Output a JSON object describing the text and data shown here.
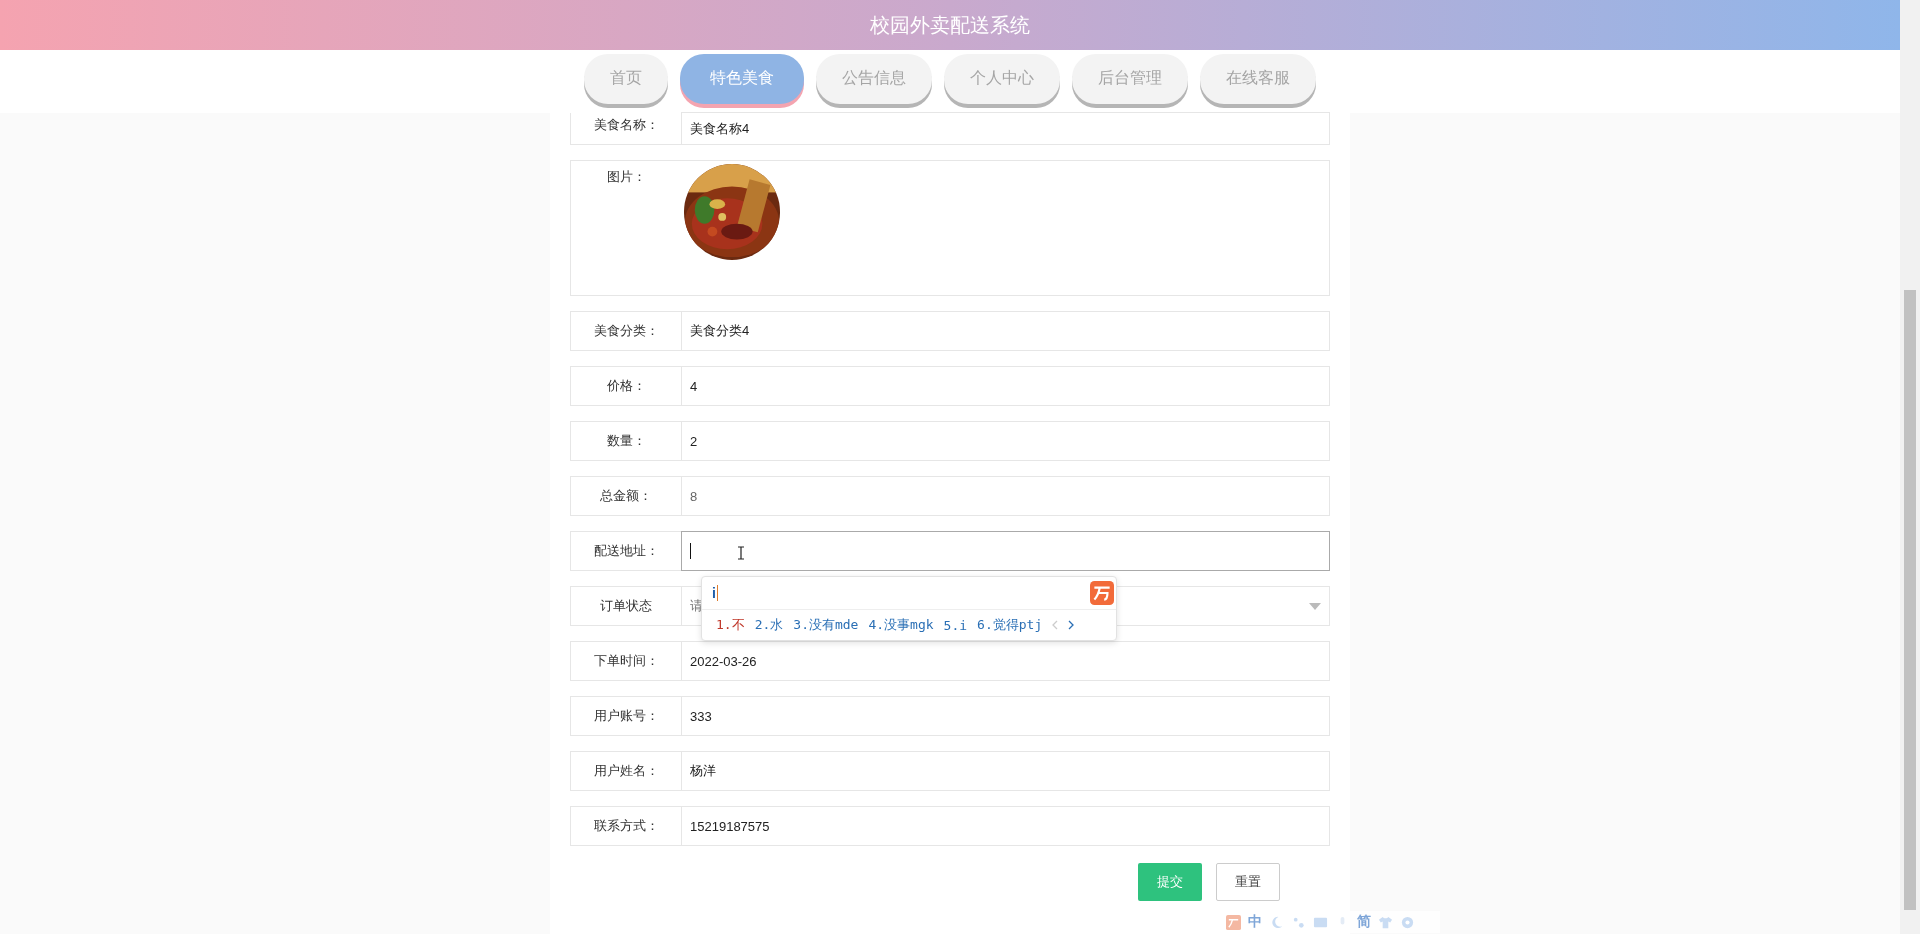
{
  "header": {
    "title": "校园外卖配送系统"
  },
  "nav": [
    {
      "label": "首页",
      "selected": false
    },
    {
      "label": "特色美食",
      "selected": true
    },
    {
      "label": "公告信息",
      "selected": false
    },
    {
      "label": "个人中心",
      "selected": false
    },
    {
      "label": "后台管理",
      "selected": false
    },
    {
      "label": "在线客服",
      "selected": false
    }
  ],
  "form": {
    "fields": [
      {
        "kind": "text",
        "label": "美食名称：",
        "value": "美食名称4",
        "readonly": false,
        "focused": false
      },
      {
        "label": "图片："
      },
      {
        "kind": "text",
        "label": "美食分类：",
        "value": "美食分类4",
        "readonly": false,
        "focused": false
      },
      {
        "kind": "text",
        "label": "价格：",
        "value": "4",
        "readonly": false,
        "focused": false
      },
      {
        "kind": "text",
        "label": "数量：",
        "value": "2",
        "readonly": false,
        "focused": false
      },
      {
        "kind": "text",
        "label": "总金额：",
        "value": "8",
        "readonly": true,
        "focused": false
      },
      {
        "kind": "text",
        "label": "配送地址：",
        "readonly": false,
        "focused": true
      },
      {
        "kind": "select",
        "label": "订单状态",
        "placeholder": "请"
      },
      {
        "kind": "text",
        "label": "下单时间：",
        "value": "2022-03-26",
        "readonly": false,
        "focused": false
      },
      {
        "kind": "text",
        "label": "用户账号：",
        "value": "333",
        "readonly": false,
        "focused": false
      },
      {
        "kind": "text",
        "label": "用户姓名：",
        "value": "杨洋",
        "readonly": false,
        "focused": false
      },
      {
        "kind": "text",
        "label": "联系方式：",
        "value": "15219187575",
        "readonly": false,
        "focused": false
      }
    ],
    "buttons": [
      {
        "label": "提交",
        "kind": "primary"
      },
      {
        "label": "重置",
        "kind": "plain"
      }
    ]
  },
  "ime": {
    "input": "i",
    "candidates": [
      {
        "text": "1.不",
        "selected": true
      },
      {
        "text": "2.水",
        "selected": false
      },
      {
        "text": "3.没有mde",
        "selected": false
      },
      {
        "text": "4.没事mgk",
        "selected": false
      },
      {
        "text": "5.i",
        "selected": false
      },
      {
        "text": "6.觉得ptj",
        "selected": false
      }
    ],
    "toolbar": [
      "中",
      "简"
    ]
  }
}
